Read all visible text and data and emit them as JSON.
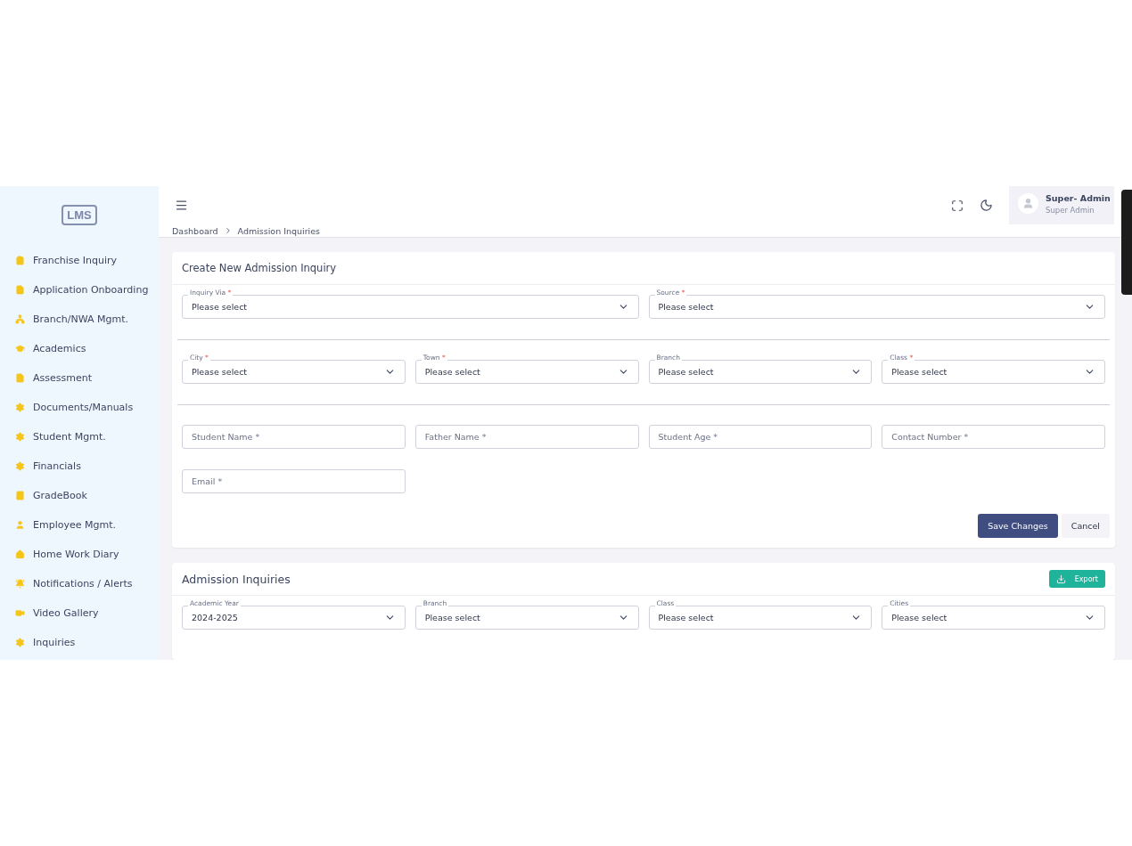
{
  "sidebar": {
    "logo": "LMS",
    "items": [
      {
        "label": "Franchise Inquiry"
      },
      {
        "label": "Application Onboarding"
      },
      {
        "label": "Branch/NWA Mgmt."
      },
      {
        "label": "Academics"
      },
      {
        "label": "Assessment"
      },
      {
        "label": "Documents/Manuals"
      },
      {
        "label": "Student Mgmt."
      },
      {
        "label": "Financials"
      },
      {
        "label": "GradeBook"
      },
      {
        "label": "Employee Mgmt."
      },
      {
        "label": "Home Work Diary"
      },
      {
        "label": "Notifications / Alerts"
      },
      {
        "label": "Video Gallery"
      },
      {
        "label": "Inquiries"
      }
    ]
  },
  "user": {
    "name": "Super- Admin",
    "role": "Super Admin"
  },
  "breadcrumb": [
    "Dashboard",
    "Admission Inquiries"
  ],
  "required_mark": "*",
  "create_form": {
    "title": "Create New Admission Inquiry",
    "rows": [
      {
        "divider": true,
        "fields": [
          {
            "kind": "select",
            "label": "Inquiry Via",
            "required": true,
            "value": "Please select"
          },
          {
            "kind": "select",
            "label": "Source",
            "required": true,
            "value": "Please select"
          }
        ]
      },
      {
        "divider": true,
        "fields": [
          {
            "kind": "select",
            "label": "City",
            "required": true,
            "value": "Please select"
          },
          {
            "kind": "select",
            "label": "Town",
            "required": true,
            "value": "Please select"
          },
          {
            "kind": "select",
            "label": "Branch",
            "required": false,
            "value": "Please select"
          },
          {
            "kind": "select",
            "label": "Class",
            "required": true,
            "value": "Please select"
          }
        ]
      },
      {
        "divider": false,
        "fields": [
          {
            "kind": "input",
            "placeholder": "Student Name *"
          },
          {
            "kind": "input",
            "placeholder": "Father Name *"
          },
          {
            "kind": "input",
            "placeholder": "Student Age *"
          },
          {
            "kind": "input",
            "placeholder": "Contact Number *"
          }
        ]
      },
      {
        "divider": false,
        "fields": [
          {
            "kind": "input",
            "placeholder": "Email *"
          }
        ]
      }
    ],
    "buttons": [
      {
        "label": "Save Changes",
        "kind": "primary"
      },
      {
        "label": "Cancel",
        "kind": "secondary"
      }
    ]
  },
  "inquiries": {
    "title": "Admission Inquiries",
    "export": "Export",
    "filters": [
      {
        "kind": "select",
        "label": "Academic Year",
        "required": false,
        "value": "2024-2025"
      },
      {
        "kind": "select",
        "label": "Branch",
        "required": false,
        "value": "Please select"
      },
      {
        "kind": "select",
        "label": "Class",
        "required": false,
        "value": "Please select"
      },
      {
        "kind": "select",
        "label": "Cities",
        "required": false,
        "value": "Please select"
      }
    ]
  }
}
